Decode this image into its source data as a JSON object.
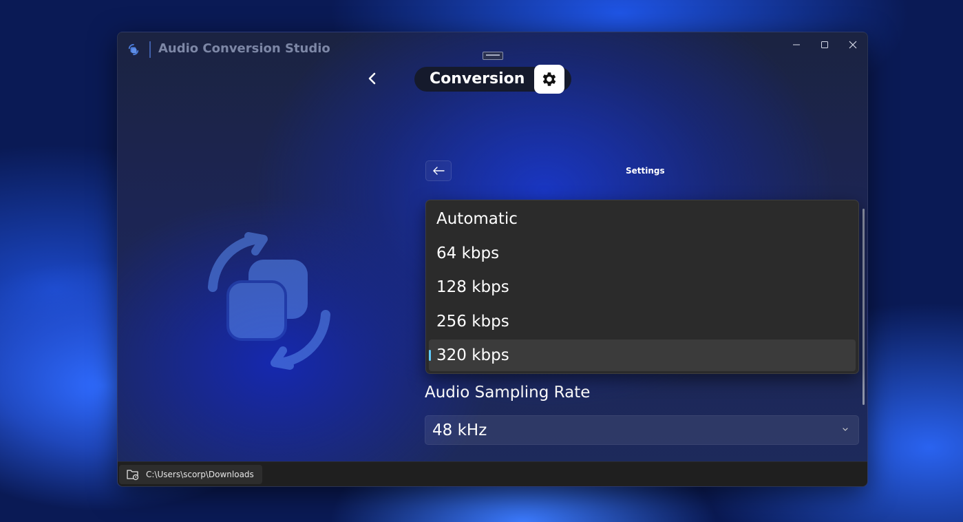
{
  "window": {
    "title": "Audio Conversion Studio",
    "controls": {
      "minimize": "—",
      "maximize": "☐",
      "close": "✕"
    }
  },
  "header": {
    "mode_label": "Conversion"
  },
  "settings": {
    "title": "Settings"
  },
  "bitrate_dropdown": {
    "options": [
      "Automatic",
      "64 kbps",
      "128 kbps",
      "256 kbps",
      "320 kbps"
    ],
    "selected": "320 kbps"
  },
  "sampling_rate": {
    "label": "Audio Sampling Rate",
    "value": "48 kHz"
  },
  "statusbar": {
    "path": "C:\\Users\\scorp\\Downloads"
  },
  "colors": {
    "accent": "#60cdff",
    "popup_bg": "#2b2b2b",
    "selected_bg": "#3b3b3b"
  },
  "icons": [
    "app-logo-icon",
    "chevron-left-icon",
    "gear-icon",
    "arrow-left-icon",
    "convert-logo-icon",
    "chevron-down-icon",
    "folder-icon"
  ]
}
